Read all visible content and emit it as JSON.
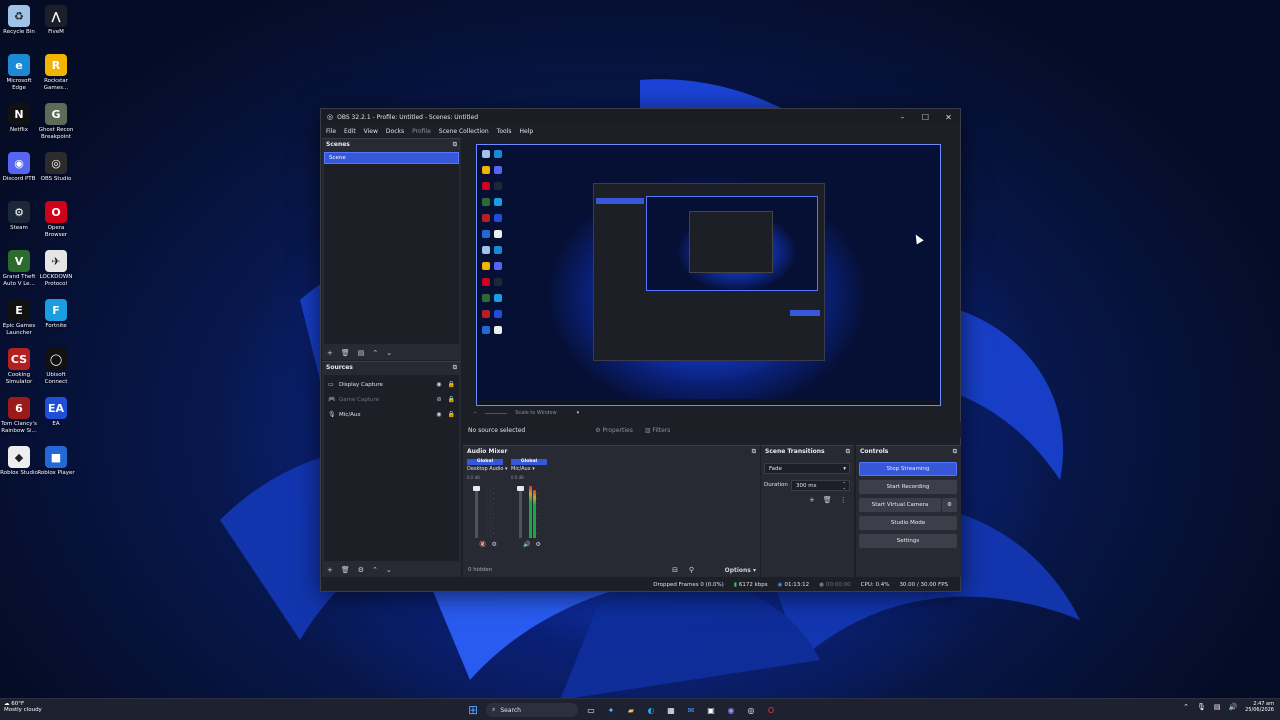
{
  "desktop": {
    "icons": [
      {
        "label": "Recycle Bin",
        "icon": "recycle-bin-icon",
        "color": "#9ec3e6",
        "glyph": "♻"
      },
      {
        "label": "FiveM",
        "icon": "fivem-icon",
        "color": "#1b1f2a",
        "glyph": "⋀"
      },
      {
        "label": "Microsoft Edge",
        "icon": "edge-icon",
        "color": "#1a8ad4",
        "glyph": "e"
      },
      {
        "label": "Rockstar Games...",
        "icon": "rockstar-icon",
        "color": "#f2b400",
        "glyph": "R"
      },
      {
        "label": "Netflix",
        "icon": "netflix-icon",
        "color": "#111",
        "glyph": "N"
      },
      {
        "label": "Ghost Recon Breakpoint",
        "icon": "ghost-recon-icon",
        "color": "#5d6b58",
        "glyph": "G"
      },
      {
        "label": "Discord PTB",
        "icon": "discord-icon",
        "color": "#5865f2",
        "glyph": "◉"
      },
      {
        "label": "OBS Studio",
        "icon": "obs-icon",
        "color": "#2b2b2b",
        "glyph": "◎"
      },
      {
        "label": "Steam",
        "icon": "steam-icon",
        "color": "#1b2838",
        "glyph": "⚙"
      },
      {
        "label": "Opera Browser",
        "icon": "opera-icon",
        "color": "#d0021b",
        "glyph": "O"
      },
      {
        "label": "Grand Theft Auto V Le...",
        "icon": "gta-icon",
        "color": "#2d6a2d",
        "glyph": "V"
      },
      {
        "label": "LOCKDOWN Protocol",
        "icon": "lockdown-icon",
        "color": "#e6e6e6",
        "glyph": "✈"
      },
      {
        "label": "Epic Games Launcher",
        "icon": "epic-games-icon",
        "color": "#111",
        "glyph": "E"
      },
      {
        "label": "Fortnite",
        "icon": "fortnite-icon",
        "color": "#1b9de0",
        "glyph": "F"
      },
      {
        "label": "Cooking Simulator",
        "icon": "cooking-sim-icon",
        "color": "#b32020",
        "glyph": "CS"
      },
      {
        "label": "Ubisoft Connect",
        "icon": "ubisoft-icon",
        "color": "#111",
        "glyph": "◯"
      },
      {
        "label": "Tom Clancy's Rainbow Si...",
        "icon": "rainbow-six-icon",
        "color": "#9b1b1b",
        "glyph": "6"
      },
      {
        "label": "EA",
        "icon": "ea-icon",
        "color": "#1e4fd6",
        "glyph": "EA"
      },
      {
        "label": "Roblox Studio",
        "icon": "roblox-studio-icon",
        "color": "#eee",
        "glyph": "◆"
      },
      {
        "label": "Roblox Player",
        "icon": "roblox-player-icon",
        "color": "#2468d6",
        "glyph": "■"
      }
    ]
  },
  "obs": {
    "title": "OBS 32.2.1 - Profile: Untitled - Scenes: Untitled",
    "menu": [
      "File",
      "Edit",
      "View",
      "Docks",
      "Profile",
      "Scene Collection",
      "Tools",
      "Help"
    ],
    "scenes": {
      "title": "Scenes",
      "items": [
        "Scene"
      ]
    },
    "sources": {
      "title": "Sources",
      "items": [
        {
          "label": "Display Capture",
          "icon": "monitor-icon"
        },
        {
          "label": "Game Capture",
          "icon": "gamepad-icon"
        },
        {
          "label": "Mic/Aux",
          "icon": "microphone-icon"
        }
      ]
    },
    "zoom_text": "Scale to Window",
    "no_source": "No source selected",
    "properties_label": "Properties",
    "filters_label": "Filters",
    "mixer": {
      "title": "Audio Mixer",
      "tracks": [
        {
          "global": "Global",
          "name": "Desktop Audio",
          "db": "0.0 dB"
        },
        {
          "global": "Global",
          "name": "Mic/Aux",
          "db": "0.0 dB"
        }
      ],
      "hidden": "0 hidden",
      "options": "Options"
    },
    "transitions": {
      "title": "Scene Transitions",
      "selected": "Fade",
      "duration_label": "Duration",
      "duration": "300 ms"
    },
    "controls": {
      "title": "Controls",
      "buttons": [
        "Stop Streaming",
        "Start Recording",
        "Start Virtual Camera",
        "Studio Mode",
        "Settings"
      ]
    },
    "status": {
      "dropped": "Dropped Frames 0 (0.0%)",
      "bitrate": "6172 kbps",
      "stream_time": "01:13:12",
      "rec_time": "00:00:00",
      "cpu": "CPU: 0.4%",
      "fps": "30.00 / 30.00 FPS"
    }
  },
  "taskbar": {
    "weather_temp": "60°F",
    "weather_desc": "Mostly cloudy",
    "search": "Search",
    "time": "2:47 am",
    "date": "25/06/2026"
  },
  "colors": {
    "accent": "#3657d8",
    "panel": "#272a33",
    "window": "#1d1f26"
  }
}
